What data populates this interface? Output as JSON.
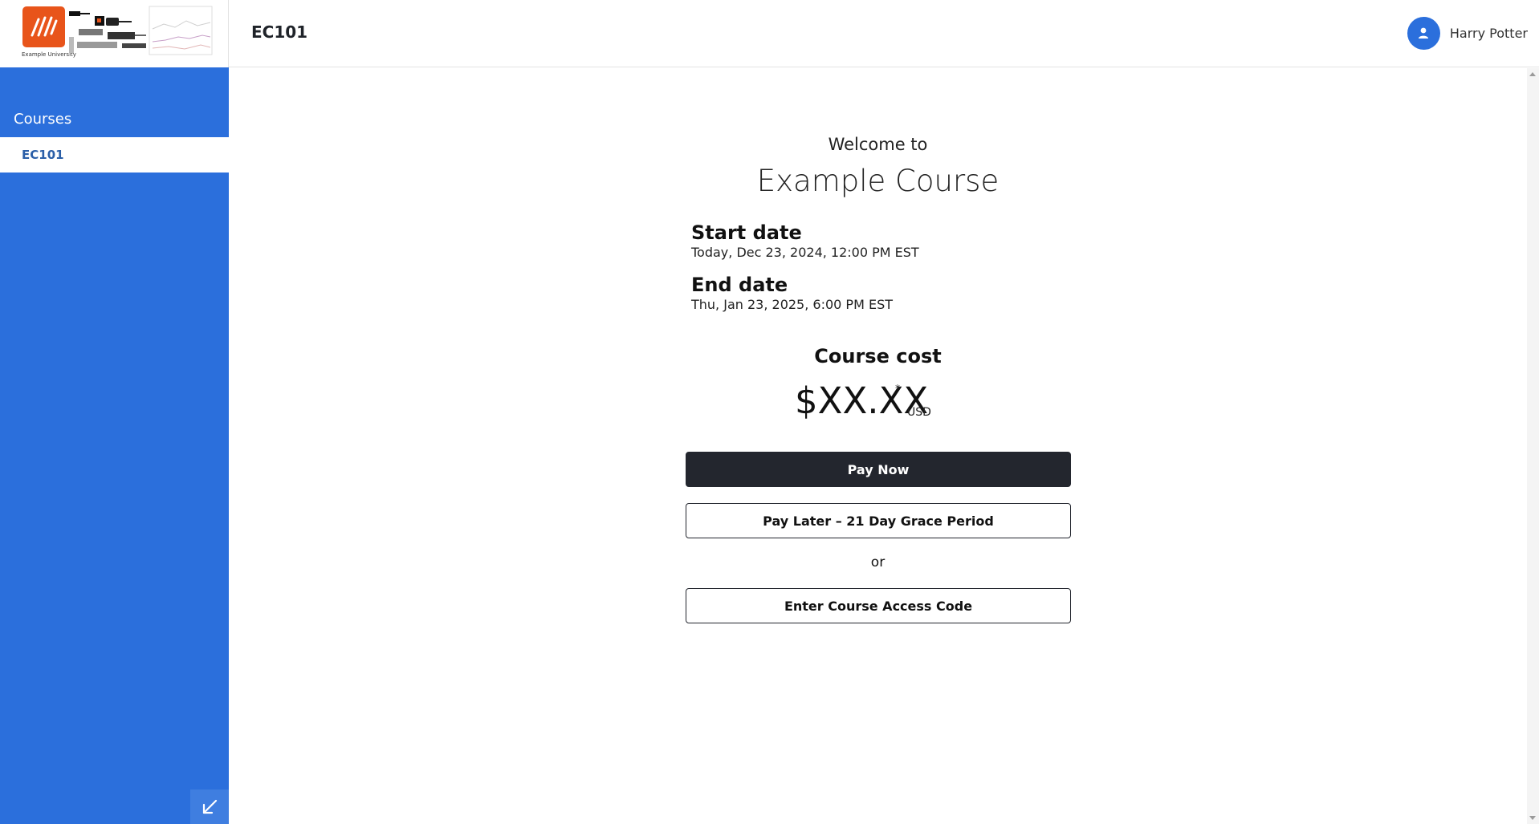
{
  "header": {
    "logo_caption": "Example University",
    "course_code": "EC101",
    "user_name": "Harry Potter"
  },
  "sidebar": {
    "heading": "Courses",
    "items": [
      {
        "label": "EC101"
      }
    ]
  },
  "main": {
    "welcome": "Welcome to",
    "course_name": "Example Course",
    "start_label": "Start date",
    "start_value": "Today, Dec 23, 2024, 12:00 PM EST",
    "end_label": "End date",
    "end_value": "Thu, Jan 23, 2025, 6:00 PM EST",
    "cost_label": "Course cost",
    "price": "$XX.XX",
    "price_note_mark": "*",
    "currency": "USD",
    "pay_now": "Pay Now",
    "pay_later": "Pay Later – 21 Day Grace Period",
    "or": "or",
    "access_code": "Enter Course Access Code"
  },
  "colors": {
    "sidebar": "#2b6fdc",
    "primary_button": "#23262e",
    "logo": "#e8541a"
  },
  "icons": {
    "avatar": "user-icon",
    "collapse": "collapse-arrow-icon"
  }
}
